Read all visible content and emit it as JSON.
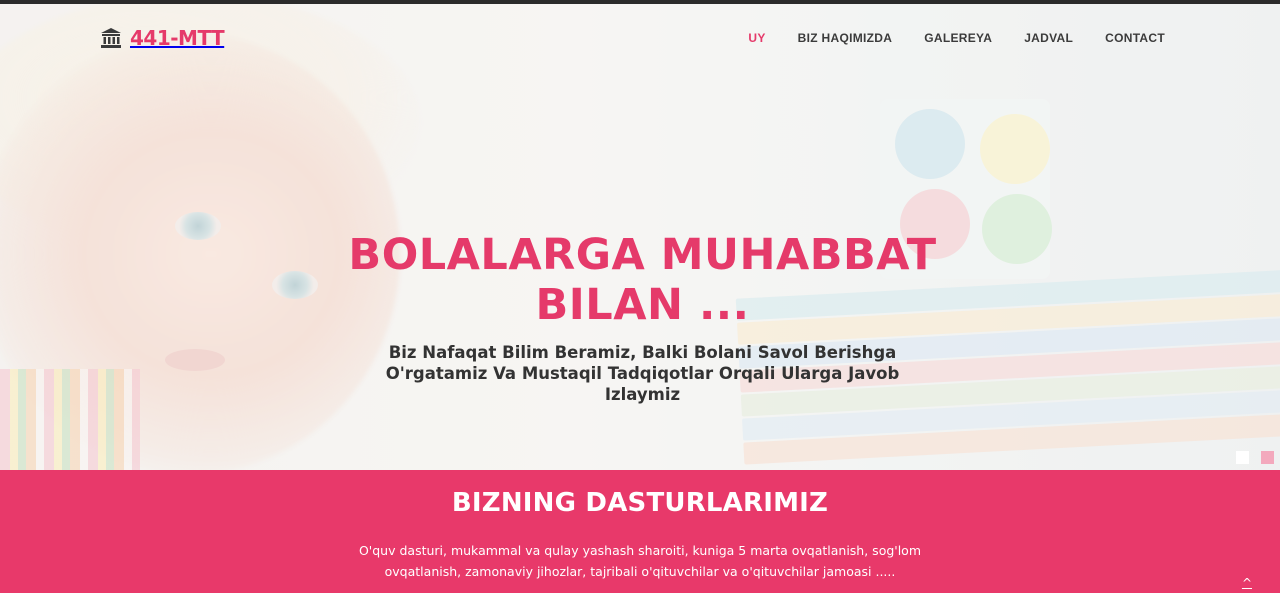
{
  "brand": {
    "name": "441-MTT",
    "icon": "institution-icon",
    "color": "#e53a6a"
  },
  "nav": {
    "items": [
      {
        "label": "UY",
        "active": true
      },
      {
        "label": "BIZ HAQIMIZDA",
        "active": false
      },
      {
        "label": "GALEREYA",
        "active": false
      },
      {
        "label": "JADVAL",
        "active": false
      },
      {
        "label": "CONTACT",
        "active": false
      }
    ]
  },
  "hero": {
    "title_line1": "BOLALARGA MUHABBAT",
    "title_line2": "BILAN ...",
    "subtitle": "Biz Nafaqat Bilim Beramiz, Balki Bolani Savol Berishga O'rgatamiz Va Mustaqil Tadqiqotlar Orqali Ularga Javob Izlaymiz",
    "slides": 2,
    "active_slide": 1
  },
  "programs": {
    "title": "BIZNING DASTURLARIMIZ",
    "text": "O'quv dasturi, mukammal va qulay yashash sharoiti, kuniga 5 marta ovqatlanish, sog'lom ovqatlanish, zamonaviy jihozlar, tajribali o'qituvchilar va o'qituvchilar jamoasi .....",
    "background": "#e8396a"
  },
  "scroll_top": {
    "icon": "chevron-up-icon",
    "glyph": "^"
  }
}
